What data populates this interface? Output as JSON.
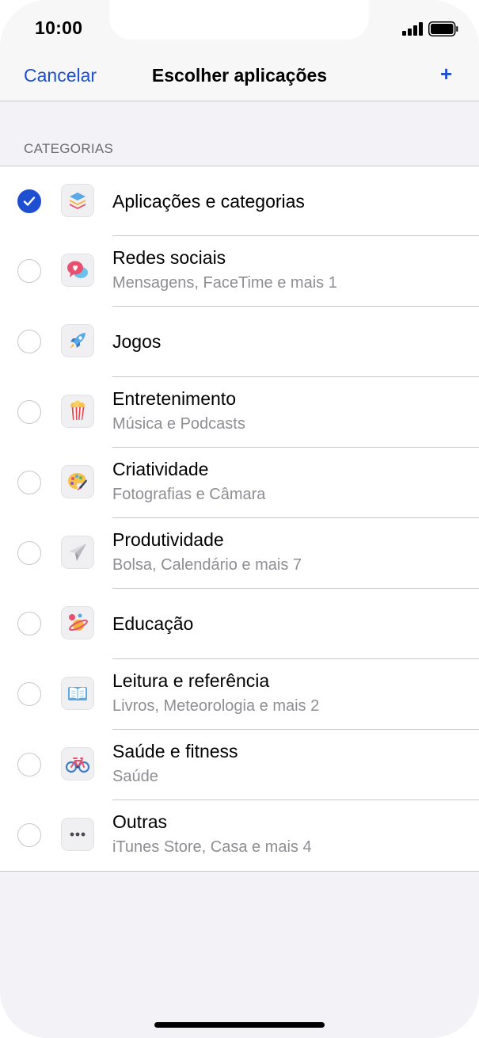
{
  "status_bar": {
    "time": "10:00"
  },
  "nav": {
    "cancel_label": "Cancelar",
    "title": "Escolher aplicações",
    "add_label": "+"
  },
  "section": {
    "header": "CATEGORIAS"
  },
  "categories": [
    {
      "title": "Aplicações e categorias",
      "subtitle": "",
      "selected": true,
      "icon": "stack-icon"
    },
    {
      "title": "Redes sociais",
      "subtitle": "Mensagens, FaceTime e mais 1",
      "selected": false,
      "icon": "chat-bubbles-icon"
    },
    {
      "title": "Jogos",
      "subtitle": "",
      "selected": false,
      "icon": "rocket-icon"
    },
    {
      "title": "Entretenimento",
      "subtitle": "Música e Podcasts",
      "selected": false,
      "icon": "popcorn-icon"
    },
    {
      "title": "Criatividade",
      "subtitle": "Fotografias e Câmara",
      "selected": false,
      "icon": "palette-icon"
    },
    {
      "title": "Produtividade",
      "subtitle": "Bolsa, Calendário e mais 7",
      "selected": false,
      "icon": "paper-plane-icon"
    },
    {
      "title": "Educação",
      "subtitle": "",
      "selected": false,
      "icon": "planet-icon"
    },
    {
      "title": "Leitura e referência",
      "subtitle": "Livros, Meteorologia e mais 2",
      "selected": false,
      "icon": "book-icon"
    },
    {
      "title": "Saúde e fitness",
      "subtitle": "Saúde",
      "selected": false,
      "icon": "bicycle-icon"
    },
    {
      "title": "Outras",
      "subtitle": "iTunes Store, Casa e mais 4",
      "selected": false,
      "icon": "ellipsis-icon"
    }
  ],
  "colors": {
    "accent": "#1f4fd1",
    "separator": "#c8c7cc",
    "secondary_text": "#8e8e93",
    "background": "#f2f2f7"
  }
}
